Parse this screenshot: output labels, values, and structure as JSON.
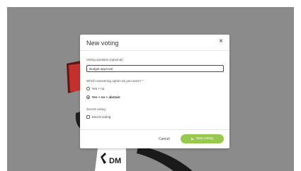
{
  "modal": {
    "title": "New voting",
    "close_icon": "×",
    "question_label": "Voting question (optional)",
    "question_value": "Budget approval",
    "options_label": "Which answering option do you want?",
    "options_required_mark": "*",
    "options": [
      {
        "label": "Yes + no",
        "selected": false
      },
      {
        "label": "Yes + no + abstain",
        "selected": true
      }
    ],
    "secret_label": "Secret voting",
    "secret_checkbox_label": "Secret voting",
    "secret_checked": false,
    "cancel_label": "Cancel",
    "start_label": "Start voting",
    "start_icon": "▶"
  },
  "background": {
    "card_text": "DM"
  },
  "colors": {
    "accent": "#98c94f",
    "backdrop": "#8b8b8b",
    "red_accent": "#c4312d"
  }
}
